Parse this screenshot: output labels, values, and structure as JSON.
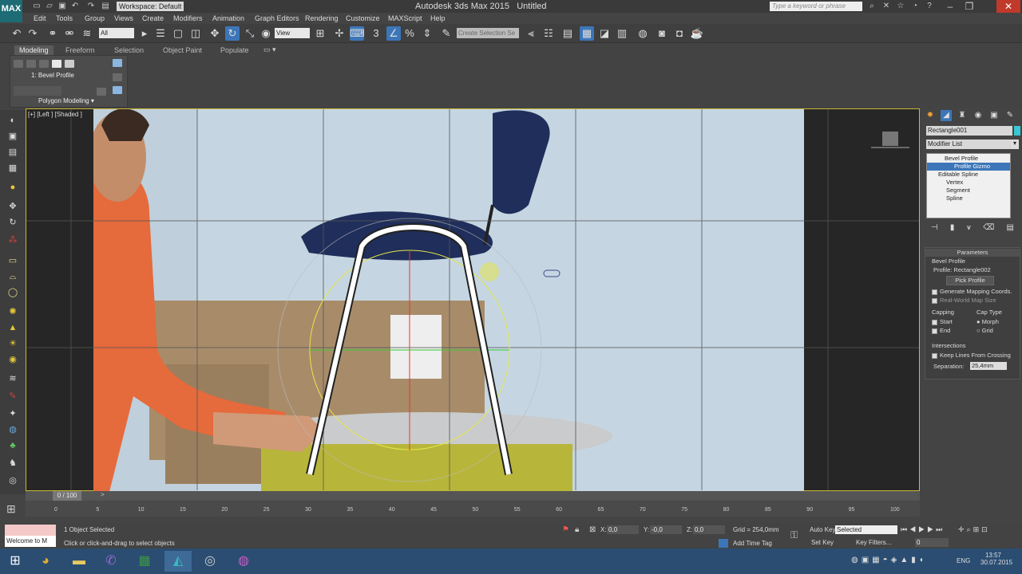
{
  "app": {
    "title": "Autodesk 3ds Max  2015",
    "file": "Untitled",
    "workspace": "Workspace: Default",
    "search_placeholder": "Type a keyword or phrase",
    "logo": "MAX"
  },
  "menus": [
    "Edit",
    "Tools",
    "Group",
    "Views",
    "Create",
    "Modifiers",
    "Animation",
    "Graph Editors",
    "Rendering",
    "Customize",
    "MAXScript",
    "Help"
  ],
  "toolbar": {
    "filter": "All",
    "coord": "View",
    "selection_set": "Create Selection Se"
  },
  "ribbon": {
    "tabs": [
      "Modeling",
      "Freeform",
      "Selection",
      "Object Paint",
      "Populate"
    ],
    "modifier_label": "1: Bevel Profile",
    "panel_label": "Polygon Modeling"
  },
  "viewport": {
    "label": "[+] [Left ] [Shaded ]"
  },
  "command_panel": {
    "object_name": "Rectangle001",
    "modifier_list": "Modifier List",
    "stack": [
      "Bevel Profile",
      "Profile Gizmo",
      "Editable Spline",
      "Vertex",
      "Segment",
      "Spline"
    ],
    "rollout_title": "Parameters",
    "group1": "Bevel Profile",
    "profile": "Profile: Rectangle002",
    "pick_button": "Pick Profile",
    "gen_mapping": "Generate Mapping Coords.",
    "real_world": "Real-World Map Size",
    "capping": "Capping",
    "cap_start": "Start",
    "cap_end": "End",
    "cap_type": "Cap Type",
    "morph": "Morph",
    "grid": "Grid",
    "intersections": "Intersections",
    "keep_lines": "Keep Lines From Crossing",
    "separation_label": "Separation:",
    "separation": "25,4mm"
  },
  "timeline": {
    "position": "0 / 100",
    "ticks": [
      "0",
      "5",
      "10",
      "15",
      "20",
      "25",
      "30",
      "35",
      "40",
      "45",
      "50",
      "55",
      "60",
      "65",
      "70",
      "75",
      "80",
      "85",
      "90",
      "95",
      "100"
    ]
  },
  "status": {
    "welcome": "Welcome to M",
    "selected": "1 Object Selected",
    "prompt": "Click or click-and-drag to select objects",
    "x": "0,0",
    "y": "-0,0",
    "z": "0,0",
    "grid": "Grid = 254,0mm",
    "add_time_tag": "Add Time Tag",
    "auto_key": "Auto Key",
    "set_key": "Set Key",
    "key_mode": "Selected",
    "key_filters": "Key Filters...",
    "frame": "0"
  },
  "taskbar": {
    "lang": "ENG",
    "time": "13:57",
    "date": "30.07.2015"
  }
}
